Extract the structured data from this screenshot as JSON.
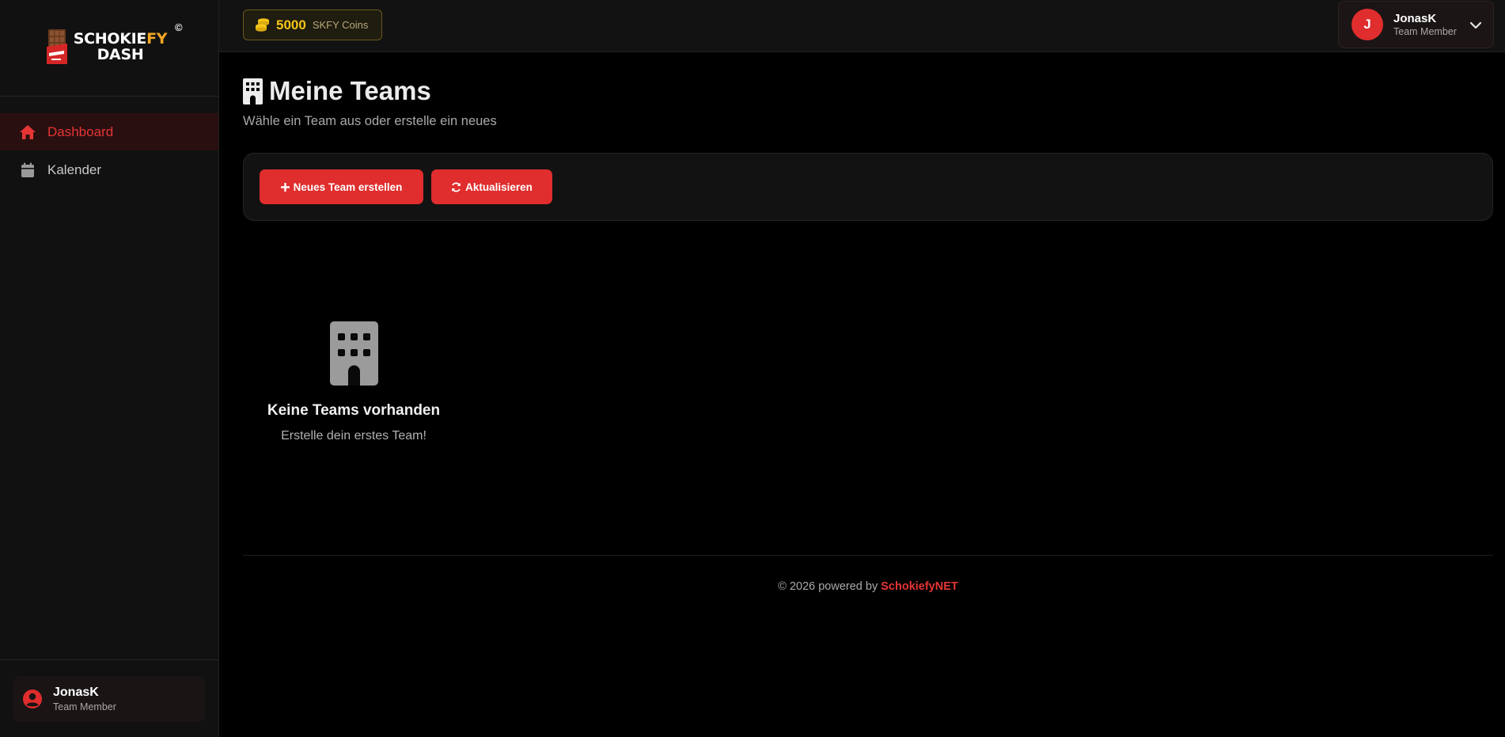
{
  "brand": {
    "logo_line1_a": "SCHOKIE",
    "logo_line1_b": "FY",
    "logo_line2": "DASH",
    "copyright_mark": "©"
  },
  "sidebar": {
    "items": [
      {
        "label": "Dashboard",
        "icon": "home-icon",
        "active": true
      },
      {
        "label": "Kalender",
        "icon": "calendar-icon",
        "active": false
      }
    ],
    "user": {
      "name": "JonasK",
      "role": "Team Member",
      "icon": "user-circle-icon"
    }
  },
  "topbar": {
    "coins": {
      "value": "5000",
      "label": "SKFY Coins",
      "icon": "coins-icon"
    },
    "user": {
      "initial": "J",
      "name": "JonasK",
      "role": "Team Member"
    }
  },
  "main": {
    "title": "Meine Teams",
    "subtitle": "Wähle ein Team aus oder erstelle ein neues",
    "buttons": {
      "new_team": "Neues Team erstellen",
      "refresh": "Aktualisieren"
    },
    "empty_state": {
      "title": "Keine Teams vorhanden",
      "subtitle": "Erstelle dein erstes Team!",
      "icon": "building-icon"
    }
  },
  "footer": {
    "text": "© 2026 powered by ",
    "brand": "SchokiefyNET"
  },
  "colors": {
    "accent": "#e02d2d",
    "accent_text": "#e53535",
    "coin_gold": "#f5c518",
    "logo_orange": "#f5a623",
    "background": "#000000",
    "sidebar_bg": "#111111"
  }
}
